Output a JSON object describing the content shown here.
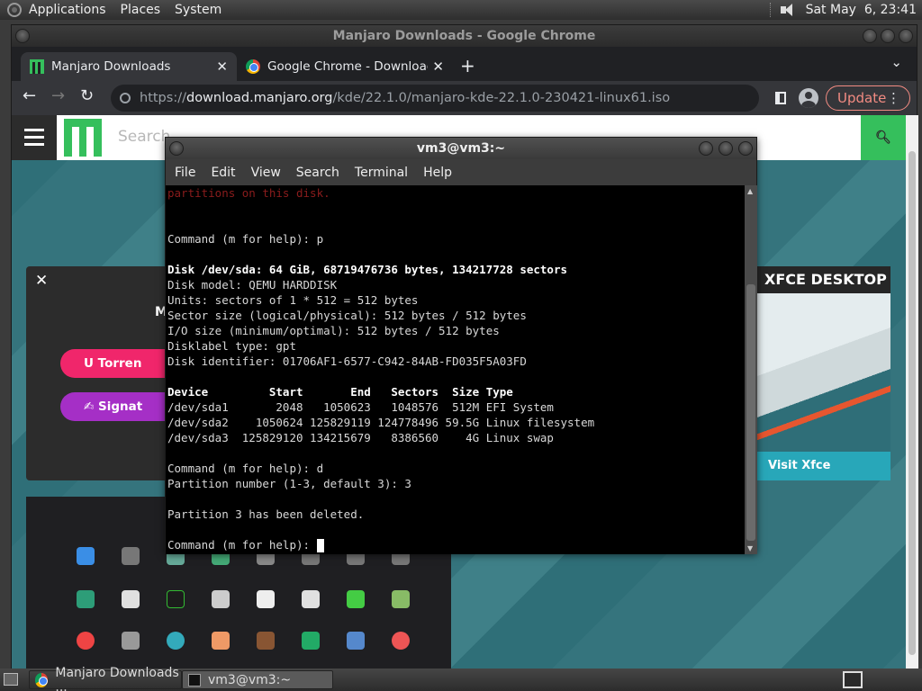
{
  "top_panel": {
    "menus": [
      "Applications",
      "Places",
      "System"
    ],
    "clock": "Sat May  6, 23:41"
  },
  "chrome": {
    "window_title": "Manjaro Downloads - Google Chrome",
    "tabs": [
      {
        "title": "Manjaro Downloads",
        "active": true
      },
      {
        "title": "Google Chrome - Download th",
        "active": false
      }
    ],
    "url_prefix": "https://",
    "url_domain": "download.manjaro.org",
    "url_path": "/kde/22.1.0/manjaro-kde-22.1.0-230421-linux61.iso",
    "update_label": "Update"
  },
  "site": {
    "search_placeholder": "Search",
    "modal_initial": "M",
    "torrent_label": "Torren",
    "signature_label": "Signat",
    "xfce_title": "XFCE DESKTOP",
    "xfce_button": "Visit Xfce"
  },
  "terminal": {
    "title": "vm3@vm3:~",
    "menus": [
      "File",
      "Edit",
      "View",
      "Search",
      "Terminal",
      "Help"
    ],
    "lines": [
      {
        "text": "partitions on this disk.",
        "style": "red"
      },
      {
        "text": "",
        "style": ""
      },
      {
        "text": "",
        "style": ""
      },
      {
        "text": "Command (m for help): p",
        "style": ""
      },
      {
        "text": "",
        "style": ""
      },
      {
        "text": "Disk /dev/sda: 64 GiB, 68719476736 bytes, 134217728 sectors",
        "style": "bold"
      },
      {
        "text": "Disk model: QEMU HARDDISK",
        "style": ""
      },
      {
        "text": "Units: sectors of 1 * 512 = 512 bytes",
        "style": ""
      },
      {
        "text": "Sector size (logical/physical): 512 bytes / 512 bytes",
        "style": ""
      },
      {
        "text": "I/O size (minimum/optimal): 512 bytes / 512 bytes",
        "style": ""
      },
      {
        "text": "Disklabel type: gpt",
        "style": ""
      },
      {
        "text": "Disk identifier: 01706AF1-6577-C942-84AB-FD035F5A03FD",
        "style": ""
      },
      {
        "text": "",
        "style": ""
      },
      {
        "text": "Device         Start       End   Sectors  Size Type",
        "style": "bold"
      },
      {
        "text": "/dev/sda1       2048   1050623   1048576  512M EFI System",
        "style": ""
      },
      {
        "text": "/dev/sda2    1050624 125829119 124778496 59.5G Linux filesystem",
        "style": ""
      },
      {
        "text": "/dev/sda3  125829120 134215679   8386560    4G Linux swap",
        "style": ""
      },
      {
        "text": "",
        "style": ""
      },
      {
        "text": "Command (m for help): d",
        "style": ""
      },
      {
        "text": "Partition number (1-3, default 3): 3",
        "style": ""
      },
      {
        "text": "",
        "style": ""
      },
      {
        "text": "Partition 3 has been deleted.",
        "style": ""
      },
      {
        "text": "",
        "style": ""
      },
      {
        "text": "Command (m for help): ",
        "style": "prompt"
      }
    ]
  },
  "taskbar": {
    "tasks": [
      {
        "label": "Manjaro Downloads ...",
        "icon": "chrome-icon",
        "active": false
      },
      {
        "label": "vm3@vm3:~",
        "icon": "terminal-icon",
        "active": true
      }
    ]
  }
}
